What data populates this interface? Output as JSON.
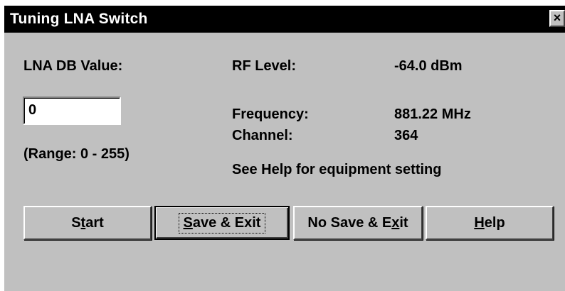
{
  "window": {
    "title": "Tuning LNA Switch",
    "close_label": "×"
  },
  "lna": {
    "label": "LNA DB Value:",
    "value": "0",
    "range": "(Range: 0 - 255)"
  },
  "rf": {
    "label": "RF Level:",
    "value": "-64.0 dBm"
  },
  "frequency": {
    "label": "Frequency:",
    "value": "881.22 MHz"
  },
  "channel": {
    "label": "Channel:",
    "value": "364"
  },
  "note": "See Help for equipment setting",
  "buttons": {
    "start": {
      "before": "S",
      "accel": "t",
      "after": "art"
    },
    "save_exit": {
      "before": "",
      "accel": "S",
      "after": "ave & Exit"
    },
    "no_save_exit": {
      "before": "No Save & E",
      "accel": "x",
      "after": "it"
    },
    "help": {
      "before": "",
      "accel": "H",
      "after": "elp"
    }
  }
}
